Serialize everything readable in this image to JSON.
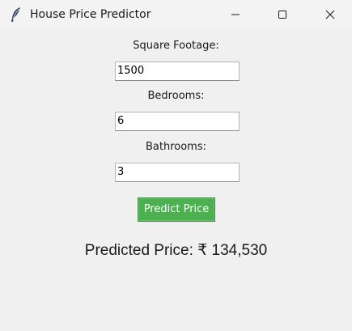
{
  "window": {
    "title": "House Price Predictor",
    "icon": "feather-icon"
  },
  "form": {
    "square_footage_label": "Square Footage:",
    "square_footage_value": "1500",
    "bedrooms_label": "Bedrooms:",
    "bedrooms_value": "6",
    "bathrooms_label": "Bathrooms:",
    "bathrooms_value": "3",
    "predict_button_label": "Predict Price",
    "predict_button_color": "#4caf50"
  },
  "result": {
    "text": "Predicted Price: ₹ 134,530"
  }
}
